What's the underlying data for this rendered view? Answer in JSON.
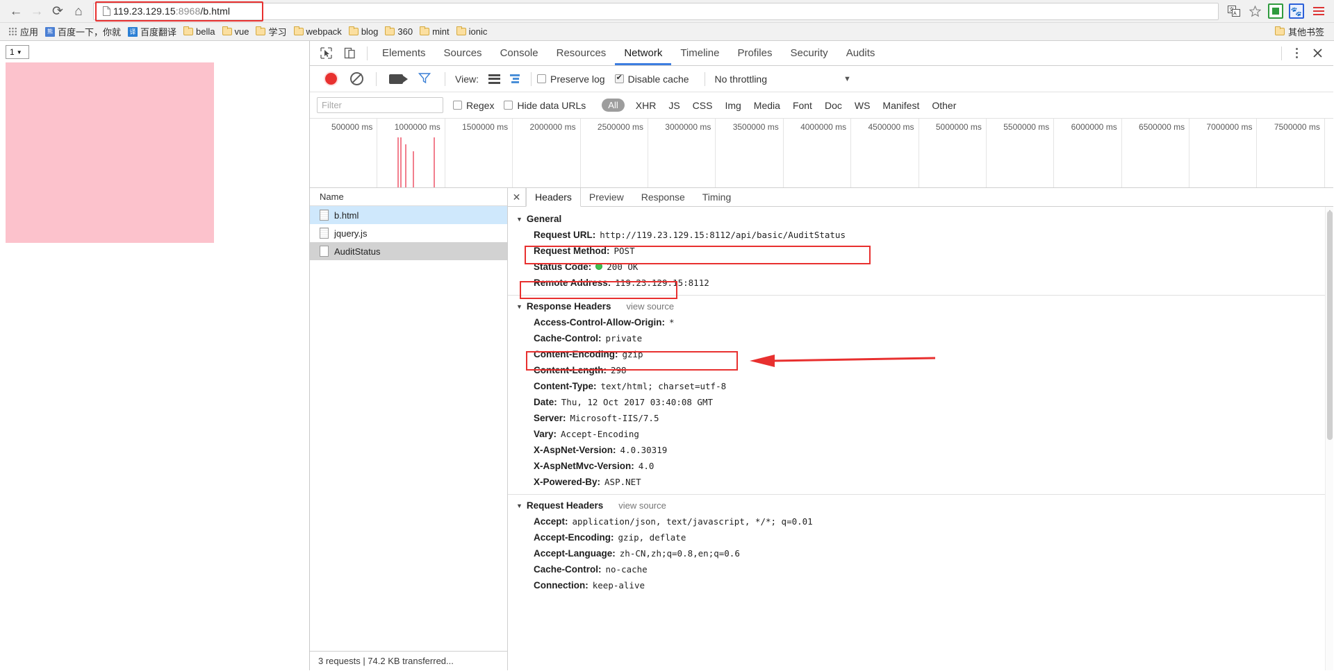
{
  "browser": {
    "nav": {
      "back_icon": "back-arrow-icon",
      "forward_icon": "forward-arrow-icon",
      "reload_icon": "reload-icon",
      "home_icon": "home-icon"
    },
    "omnibox": {
      "page_icon": "page-document-icon",
      "url_host": "119.23.129.15",
      "url_port": ":8968",
      "url_path": "/b.html",
      "full_url": "119.23.129.15:8968/b.html",
      "highlight_color": "#e8302f"
    },
    "toolbar_icons": {
      "translate": "translate-icon",
      "bookmark_star": "star-icon",
      "green_extension": "green-extension-icon",
      "blue_extension": "blue-paw-extension-icon",
      "menu": "hamburger-menu-icon"
    },
    "bookmarks": [
      {
        "label": "应用",
        "icon": "apps-grid-icon"
      },
      {
        "label": "百度一下，你就",
        "icon": "baidu-favicon"
      },
      {
        "label": "百度翻译",
        "icon": "baidu-translate-favicon"
      },
      {
        "label": "bella",
        "icon": "folder-icon"
      },
      {
        "label": "vue",
        "icon": "folder-icon"
      },
      {
        "label": "学习",
        "icon": "folder-icon"
      },
      {
        "label": "webpack",
        "icon": "folder-icon"
      },
      {
        "label": "blog",
        "icon": "folder-icon"
      },
      {
        "label": "360",
        "icon": "folder-icon"
      },
      {
        "label": "mint",
        "icon": "folder-icon"
      },
      {
        "label": "ionic",
        "icon": "folder-icon"
      }
    ],
    "other_bookmarks": {
      "label": "其他书签",
      "icon": "folder-icon"
    }
  },
  "page": {
    "select_value": "1",
    "select_caret": "▼",
    "pink_box_color": "#fcc2cc"
  },
  "devtools": {
    "tools": {
      "inspect_icon": "inspect-cursor-icon",
      "device_icon": "device-toolbar-icon"
    },
    "tabs": [
      {
        "label": "Elements",
        "active": false
      },
      {
        "label": "Sources",
        "active": false
      },
      {
        "label": "Console",
        "active": false
      },
      {
        "label": "Resources",
        "active": false
      },
      {
        "label": "Network",
        "active": true
      },
      {
        "label": "Timeline",
        "active": false
      },
      {
        "label": "Profiles",
        "active": false
      },
      {
        "label": "Security",
        "active": false
      },
      {
        "label": "Audits",
        "active": false
      }
    ],
    "right_icons": {
      "more": "kebab-menu-icon",
      "close": "close-icon"
    },
    "active_tab_underline": "#3c7de0",
    "toolbar": {
      "record_icon": "record-button-icon",
      "record_color": "#e8312f",
      "clear_icon": "clear-icon",
      "capture_icon": "camera-screenshots-icon",
      "filter_icon": "funnel-filter-icon",
      "view_label": "View:",
      "view_list_icon": "list-view-icon",
      "view_waterfall_icon": "waterfall-view-icon",
      "preserve_log": {
        "label": "Preserve log",
        "checked": false
      },
      "disable_cache": {
        "label": "Disable cache",
        "checked": true
      },
      "throttling": {
        "value": "No throttling",
        "caret": "▼"
      }
    },
    "filterbar": {
      "filter_placeholder": "Filter",
      "filter_value": "",
      "regex": {
        "label": "Regex",
        "checked": false
      },
      "hide_data_urls": {
        "label": "Hide data URLs",
        "checked": false
      },
      "types": [
        {
          "label": "All",
          "active": true
        },
        {
          "label": "XHR",
          "active": false
        },
        {
          "label": "JS",
          "active": false
        },
        {
          "label": "CSS",
          "active": false
        },
        {
          "label": "Img",
          "active": false
        },
        {
          "label": "Media",
          "active": false
        },
        {
          "label": "Font",
          "active": false
        },
        {
          "label": "Doc",
          "active": false
        },
        {
          "label": "WS",
          "active": false
        },
        {
          "label": "Manifest",
          "active": false
        },
        {
          "label": "Other",
          "active": false
        }
      ]
    },
    "overview": {
      "ticks": [
        "500000 ms",
        "1000000 ms",
        "1500000 ms",
        "2000000 ms",
        "2500000 ms",
        "3000000 ms",
        "3500000 ms",
        "4000000 ms",
        "4500000 ms",
        "5000000 ms",
        "5500000 ms",
        "6000000 ms",
        "6500000 ms",
        "7000000 ms",
        "7500000 ms"
      ],
      "bar_color": "#f27e8d"
    },
    "requests": {
      "column_header": "Name",
      "rows": [
        {
          "name": "b.html",
          "icon": "document-icon",
          "state": "selected"
        },
        {
          "name": "jquery.js",
          "icon": "document-icon",
          "state": "normal"
        },
        {
          "name": "AuditStatus",
          "icon": "document-icon",
          "state": "hovered"
        }
      ],
      "status": "3 requests  |  74.2 KB transferred..."
    },
    "detail": {
      "close_icon": "close-icon",
      "tabs": [
        {
          "label": "Headers",
          "active": true
        },
        {
          "label": "Preview",
          "active": false
        },
        {
          "label": "Response",
          "active": false
        },
        {
          "label": "Timing",
          "active": false
        }
      ],
      "sections": [
        {
          "title": "General",
          "view_source": null,
          "rows": [
            {
              "key": "Request URL:",
              "value": "http://119.23.129.15:8112/api/basic/AuditStatus",
              "highlight": true
            },
            {
              "key": "Request Method:",
              "value": "POST"
            },
            {
              "key": "Status Code:",
              "value": "200 OK",
              "status_dot": true,
              "highlight_key": true
            },
            {
              "key": "Remote Address:",
              "value": "119.23.129.15:8112"
            }
          ]
        },
        {
          "title": "Response Headers",
          "view_source": "view source",
          "rows": [
            {
              "key": "Access-Control-Allow-Origin:",
              "value": "*",
              "highlight": true,
              "arrow": true
            },
            {
              "key": "Cache-Control:",
              "value": "private"
            },
            {
              "key": "Content-Encoding:",
              "value": "gzip"
            },
            {
              "key": "Content-Length:",
              "value": "298"
            },
            {
              "key": "Content-Type:",
              "value": "text/html; charset=utf-8"
            },
            {
              "key": "Date:",
              "value": "Thu, 12 Oct 2017 03:40:08 GMT"
            },
            {
              "key": "Server:",
              "value": "Microsoft-IIS/7.5"
            },
            {
              "key": "Vary:",
              "value": "Accept-Encoding"
            },
            {
              "key": "X-AspNet-Version:",
              "value": "4.0.30319"
            },
            {
              "key": "X-AspNetMvc-Version:",
              "value": "4.0"
            },
            {
              "key": "X-Powered-By:",
              "value": "ASP.NET"
            }
          ]
        },
        {
          "title": "Request Headers",
          "view_source": "view source",
          "rows": [
            {
              "key": "Accept:",
              "value": "application/json, text/javascript, */*; q=0.01"
            },
            {
              "key": "Accept-Encoding:",
              "value": "gzip, deflate"
            },
            {
              "key": "Accept-Language:",
              "value": "zh-CN,zh;q=0.8,en;q=0.6"
            },
            {
              "key": "Cache-Control:",
              "value": "no-cache"
            },
            {
              "key": "Connection:",
              "value": "keep-alive"
            }
          ]
        }
      ],
      "annotation_color": "#e8302f"
    }
  }
}
